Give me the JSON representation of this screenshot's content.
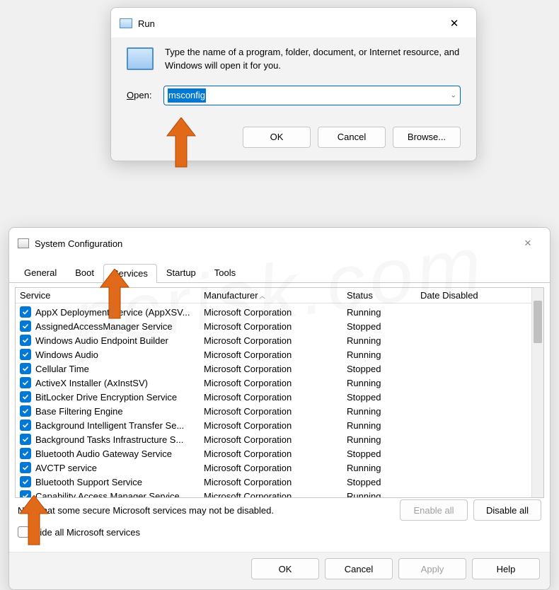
{
  "run": {
    "title": "Run",
    "description": "Type the name of a program, folder, document, or Internet resource, and Windows will open it for you.",
    "open_label": "Open:",
    "input_value": "msconfig",
    "buttons": {
      "ok": "OK",
      "cancel": "Cancel",
      "browse": "Browse..."
    }
  },
  "sysconfig": {
    "title": "System Configuration",
    "tabs": [
      "General",
      "Boot",
      "Services",
      "Startup",
      "Tools"
    ],
    "active_tab": "Services",
    "columns": {
      "service": "Service",
      "manufacturer": "Manufacturer",
      "status": "Status",
      "date_disabled": "Date Disabled"
    },
    "sort_column": "manufacturer",
    "services": [
      {
        "name": "AppX Deployment Service (AppXSV...",
        "manufacturer": "Microsoft Corporation",
        "status": "Running",
        "checked": true
      },
      {
        "name": "AssignedAccessManager Service",
        "manufacturer": "Microsoft Corporation",
        "status": "Stopped",
        "checked": true
      },
      {
        "name": "Windows Audio Endpoint Builder",
        "manufacturer": "Microsoft Corporation",
        "status": "Running",
        "checked": true
      },
      {
        "name": "Windows Audio",
        "manufacturer": "Microsoft Corporation",
        "status": "Running",
        "checked": true
      },
      {
        "name": "Cellular Time",
        "manufacturer": "Microsoft Corporation",
        "status": "Stopped",
        "checked": true
      },
      {
        "name": "ActiveX Installer (AxInstSV)",
        "manufacturer": "Microsoft Corporation",
        "status": "Running",
        "checked": true
      },
      {
        "name": "BitLocker Drive Encryption Service",
        "manufacturer": "Microsoft Corporation",
        "status": "Stopped",
        "checked": true
      },
      {
        "name": "Base Filtering Engine",
        "manufacturer": "Microsoft Corporation",
        "status": "Running",
        "checked": true
      },
      {
        "name": "Background Intelligent Transfer Se...",
        "manufacturer": "Microsoft Corporation",
        "status": "Running",
        "checked": true
      },
      {
        "name": "Background Tasks Infrastructure S...",
        "manufacturer": "Microsoft Corporation",
        "status": "Running",
        "checked": true
      },
      {
        "name": "Bluetooth Audio Gateway Service",
        "manufacturer": "Microsoft Corporation",
        "status": "Stopped",
        "checked": true
      },
      {
        "name": "AVCTP service",
        "manufacturer": "Microsoft Corporation",
        "status": "Running",
        "checked": true
      },
      {
        "name": "Bluetooth Support Service",
        "manufacturer": "Microsoft Corporation",
        "status": "Stopped",
        "checked": true
      },
      {
        "name": "Capability Access Manager Service",
        "manufacturer": "Microsoft Corporation",
        "status": "Running",
        "checked": true
      }
    ],
    "note": "Note that some secure Microsoft services may not be disabled.",
    "enable_all": "Enable all",
    "disable_all": "Disable all",
    "hide_ms": "Hide all Microsoft services",
    "footer": {
      "ok": "OK",
      "cancel": "Cancel",
      "apply": "Apply",
      "help": "Help"
    }
  },
  "watermark": "pcrisk.com"
}
